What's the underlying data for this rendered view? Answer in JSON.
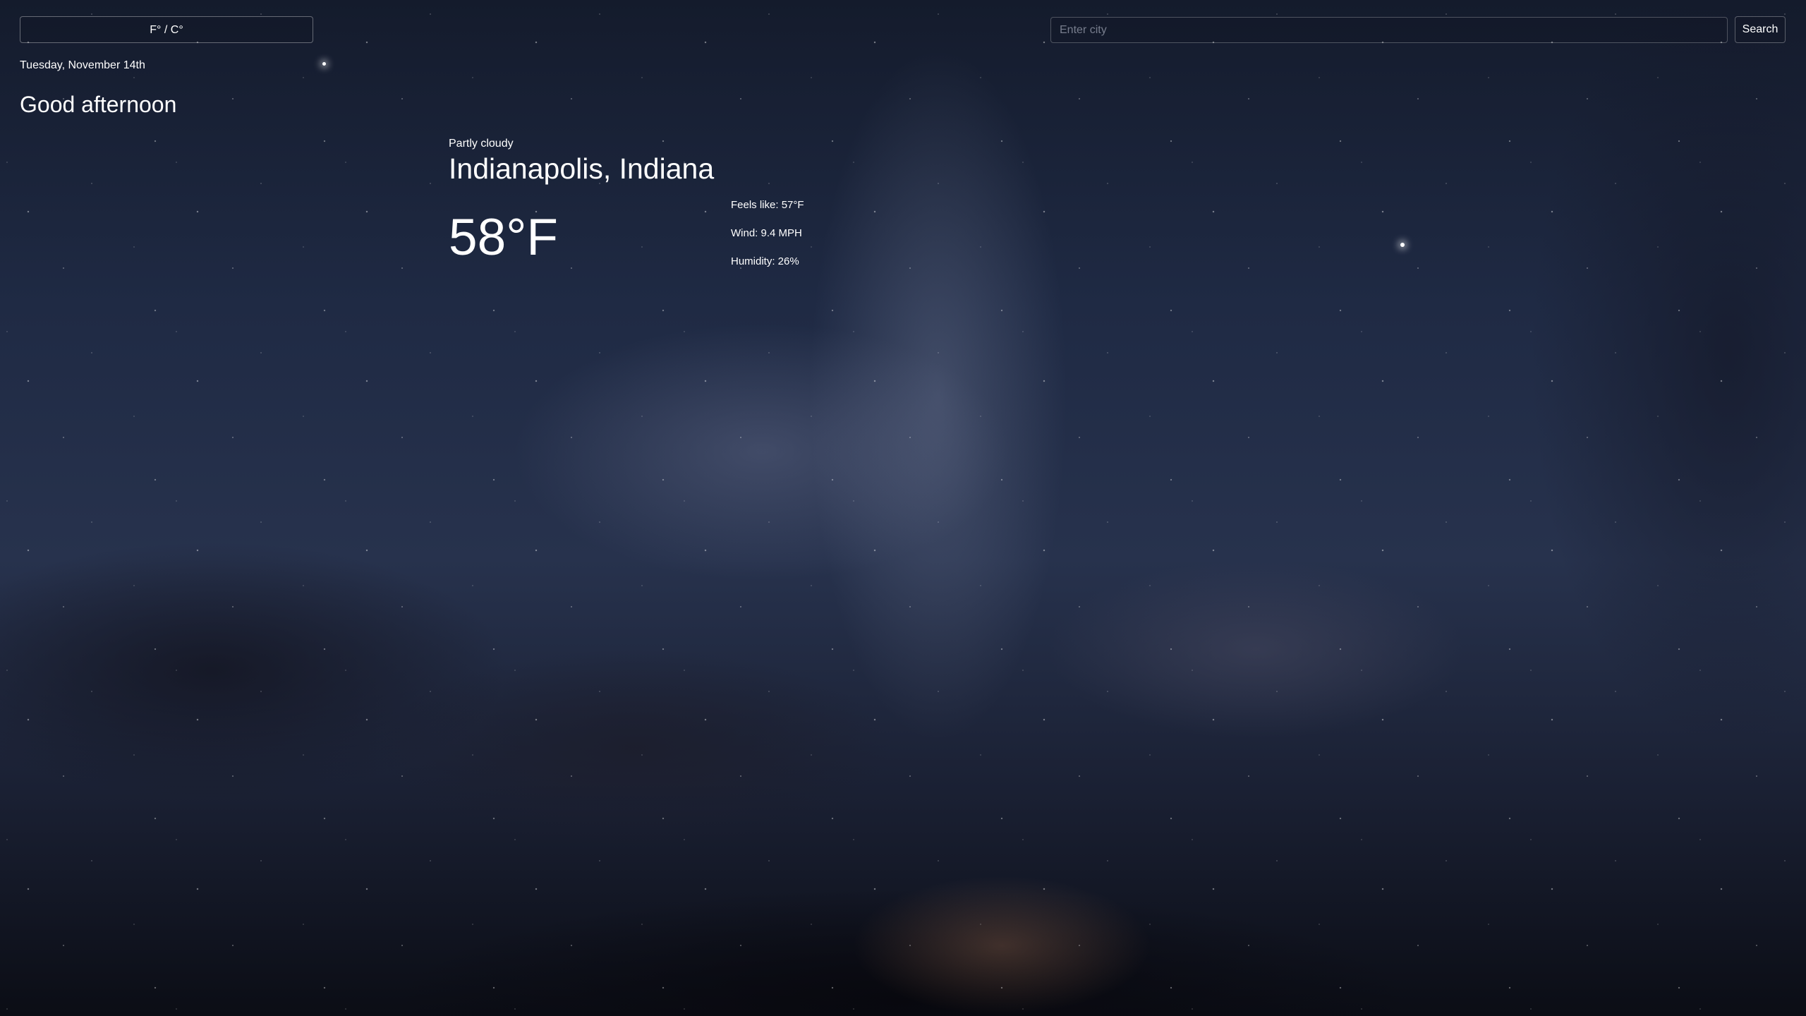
{
  "header": {
    "unit_toggle_label": "F° / C°",
    "search_placeholder": "Enter city",
    "search_value": "",
    "search_button_label": "Search"
  },
  "date": "Tuesday, November 14th",
  "greeting": "Good afternoon",
  "weather": {
    "condition": "Partly cloudy",
    "location": "Indianapolis, Indiana",
    "temperature": "58°F",
    "feels_like": "Feels like: 57°F",
    "wind": "Wind: 9.4 MPH",
    "humidity": "Humidity: 26%"
  }
}
